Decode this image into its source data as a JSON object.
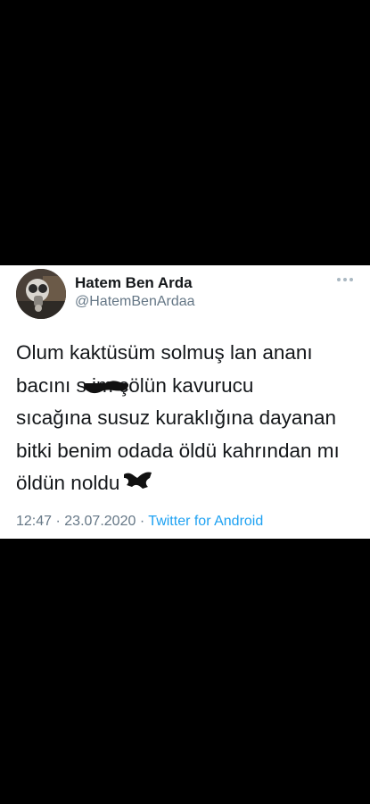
{
  "tweet": {
    "display_name": "Hatem Ben Arda",
    "handle": "@HatemBenArdaa",
    "lines": [
      "Olum kaktüsüm solmuş lan ananı",
      "bacını s        im çölün kavurucu",
      "sıcağına susuz kuraklığına dayanan",
      "bitki benim odada öldü kahrından mı",
      "öldün noldu"
    ],
    "time": "12:47",
    "separator": "·",
    "date": "23.07.2020",
    "source": "Twitter for Android"
  },
  "colors": {
    "background": "#000000",
    "card": "#ffffff",
    "text": "#14171a",
    "secondary": "#657786",
    "link": "#1da1f2",
    "scribble": "#111111"
  },
  "icons": {
    "more": "more-dots-icon",
    "redaction": "scribble-redaction"
  }
}
